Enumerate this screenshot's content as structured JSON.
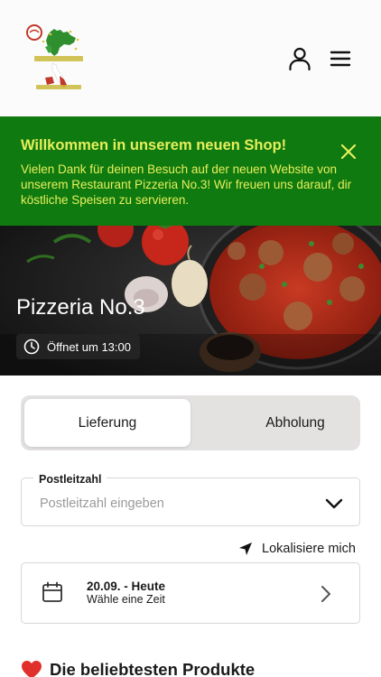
{
  "header": {
    "logo_icon": "pizzeria-italy-map-logo",
    "user_icon": "user-icon",
    "menu_icon": "hamburger-menu-icon"
  },
  "banner": {
    "title": "Willkommen in unserem neuen Shop!",
    "text": "Vielen Dank für deinen Besuch auf der neuen Website von unserem Restaurant Pizzeria No.3! Wir freuen uns darauf, dir köstliche Speisen zu servieren.",
    "background": "#0f7a0f",
    "text_color": "#e7ef5c"
  },
  "hero": {
    "title": "Pizzeria No.3",
    "hours": "Öffnet um 13:00"
  },
  "order_mode": {
    "tabs": [
      {
        "label": "Lieferung",
        "active": true
      },
      {
        "label": "Abholung",
        "active": false
      }
    ]
  },
  "postal": {
    "label": "Postleitzahl",
    "placeholder": "Postleitzahl eingeben",
    "value": ""
  },
  "locate": {
    "label": "Lokalisiere mich"
  },
  "time": {
    "date": "20.09. - Heute",
    "subtitle": "Wähle eine Zeit"
  },
  "products": {
    "title": "Die beliebtesten Produkte",
    "icon": "heart-icon"
  }
}
